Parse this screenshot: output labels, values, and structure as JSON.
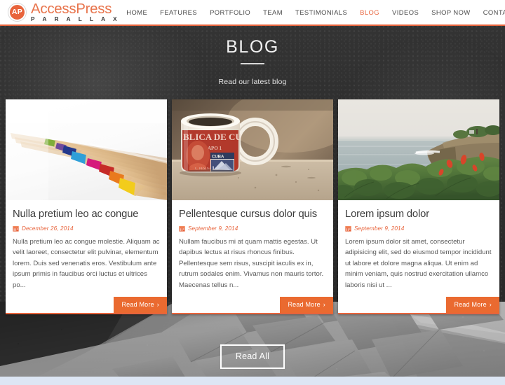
{
  "header": {
    "logo": {
      "mark": "AP",
      "name": "AccessPress",
      "tagline": "P A R A L L A X",
      "mark_color": "#e8643c",
      "name_color": "#e8744c"
    },
    "nav": [
      {
        "label": "HOME",
        "active": false
      },
      {
        "label": "FEATURES",
        "active": false
      },
      {
        "label": "PORTFOLIO",
        "active": false
      },
      {
        "label": "TEAM",
        "active": false
      },
      {
        "label": "TESTIMONIALS",
        "active": false
      },
      {
        "label": "BLOG",
        "active": true
      },
      {
        "label": "VIDEOS",
        "active": false
      },
      {
        "label": "SHOP NOW",
        "active": false
      },
      {
        "label": "CONTACT",
        "active": false
      }
    ],
    "accent_color": "#e8643c"
  },
  "blog": {
    "title": "BLOG",
    "subtitle": "Read our latest blog",
    "read_all_label": "Read All",
    "posts": [
      {
        "title": "Nulla pretium leo ac congue",
        "date": "December 26, 2014",
        "excerpt": "Nulla pretium leo ac congue molestie. Aliquam ac velit laoreet, consectetur elit pulvinar, elementum lorem. Duis sed venenatis eros. Vestibulum ante ipsum primis in faucibus orci luctus et ultrices po...",
        "read_more_label": "Read More",
        "image_alt": "colored-pencils-photo"
      },
      {
        "title": "Pellentesque cursus dolor quis",
        "date": "September 9, 2014",
        "excerpt": "Nullam faucibus mi at quam mattis egestas. Ut dapibus lectus at risus rhoncus finibus. Pellentesque sem risus, suscipit iaculis ex in, rutrum sodales enim. Vivamus non mauris tortor. Maecenas tellus n...",
        "read_more_label": "Read More",
        "image_alt": "cuban-stamp-coffee-mug-photo"
      },
      {
        "title": "Lorem ipsum dolor",
        "date": "September 9, 2014",
        "excerpt": "Lorem ipsum dolor sit amet, consectetur adipisicing elit, sed do eiusmod tempor incididunt ut labore et dolore magna aliqua. Ut enim ad minim veniam, quis nostrud exercitation ullamco laboris nisi ut ...",
        "read_more_label": "Read More",
        "image_alt": "coastal-seascape-photo"
      }
    ],
    "read_more_chevron": "›",
    "button_color": "#ea6a30",
    "background_style": "dark-textured-with-grayscale-keyboard-photo"
  }
}
